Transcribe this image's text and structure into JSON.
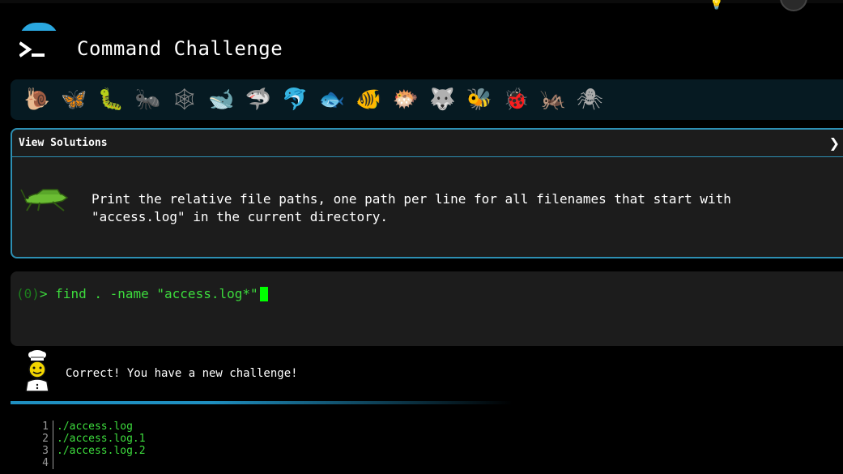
{
  "app": {
    "title": "Command Challenge"
  },
  "animals": [
    {
      "name": "snail",
      "glyph": "🐌",
      "color": "#b8865a"
    },
    {
      "name": "butterfly",
      "glyph": "🦋",
      "color": "#e08a2a"
    },
    {
      "name": "caterpillar",
      "glyph": "🐛",
      "color": "#66c23a"
    },
    {
      "name": "ant",
      "glyph": "🐜",
      "color": "#888888"
    },
    {
      "name": "spider-web",
      "glyph": "🕸",
      "color": "#888888"
    },
    {
      "name": "whale",
      "glyph": "🐋",
      "color": "#4aa3d8"
    },
    {
      "name": "shark",
      "glyph": "🦈",
      "color": "#5aa8d8"
    },
    {
      "name": "dolphin",
      "glyph": "🐬",
      "color": "#9aa8b0"
    },
    {
      "name": "fish",
      "glyph": "🐟",
      "color": "#3aa0e0"
    },
    {
      "name": "tropical-fish",
      "glyph": "🐠",
      "color": "#f2c200"
    },
    {
      "name": "blowfish",
      "glyph": "🐡",
      "color": "#c8864a"
    },
    {
      "name": "wolf",
      "glyph": "🐺",
      "color": "#8a8a8a"
    },
    {
      "name": "bee",
      "glyph": "🐝",
      "color": "#f2c200"
    },
    {
      "name": "ladybug",
      "glyph": "🐞",
      "color": "#e02a2a"
    },
    {
      "name": "cricket",
      "glyph": "🦗",
      "color": "#6bc23a"
    },
    {
      "name": "spider",
      "glyph": "🕷",
      "color": "#aaaaaa"
    }
  ],
  "challenge": {
    "view_solutions_label": "View Solutions",
    "toggle_glyph": "❯",
    "text": "Print the relative file paths, one path per line for all filenames that start with \"access.log\" in the current directory."
  },
  "terminal": {
    "status": "(0)",
    "prompt": "> ",
    "command": "find . -name \"access.log*\""
  },
  "result": {
    "message": "Correct! You have a new challenge!"
  },
  "output": {
    "lines": [
      {
        "n": "1",
        "text": "./access.log"
      },
      {
        "n": "2",
        "text": "./access.log.1"
      },
      {
        "n": "3",
        "text": "./access.log.2"
      },
      {
        "n": "4",
        "text": ""
      }
    ]
  },
  "colors": {
    "accent": "#2d8fb3",
    "terminal_green": "#3ddc3d",
    "card_bg": "#1c1c1c",
    "strip_bg": "#061a22"
  }
}
